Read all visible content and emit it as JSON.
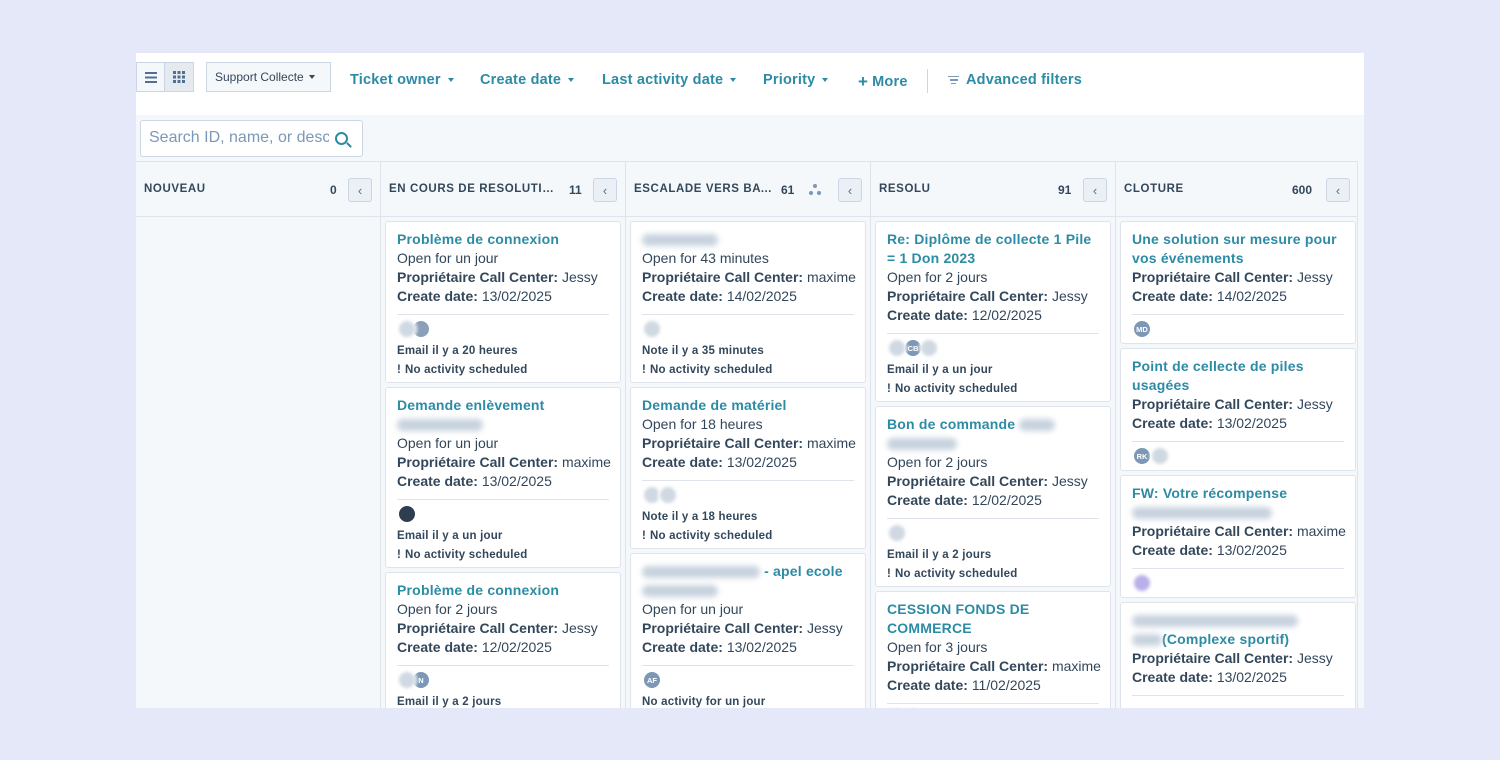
{
  "toolbar": {
    "view_list_icon": "list-view-icon",
    "view_board_icon": "board-view-icon",
    "pipeline": "Support Collecte",
    "filters": {
      "ticket_owner": "Ticket owner",
      "create_date": "Create date",
      "last_activity_date": "Last activity date",
      "priority": "Priority",
      "more": "More",
      "advanced": "Advanced filters"
    }
  },
  "search": {
    "placeholder": "Search ID, name, or desc"
  },
  "columns": [
    {
      "name": "NOUVEAU",
      "count": "0",
      "cards": []
    },
    {
      "name": "EN COURS DE RÉSOLUTION…",
      "count": "11",
      "cards": [
        {
          "title": "Problème de connexion",
          "open": "Open for un jour",
          "owner_label": "Propriétaire Call Center:",
          "owner": "Jessy",
          "date_label": "Create date:",
          "date": "13/02/2025",
          "activity": "Email il y a 20 heures",
          "next": "No activity scheduled"
        },
        {
          "title": "Demande enlèvement",
          "open": "Open for un jour",
          "owner_label": "Propriétaire Call Center:",
          "owner": "maxime",
          "date_label": "Create date:",
          "date": "13/02/2025",
          "activity": "Email il y a un jour",
          "next": "No activity scheduled"
        },
        {
          "title": "Problème de connexion",
          "open": "Open for 2 jours",
          "owner_label": "Propriétaire Call Center:",
          "owner": "Jessy",
          "date_label": "Create date:",
          "date": "12/02/2025",
          "activity": "Email il y a 2 jours",
          "avatar": "N"
        }
      ]
    },
    {
      "name": "ESCALADE VERS BATR…",
      "count": "61",
      "cards": [
        {
          "open": "Open for 43 minutes",
          "owner_label": "Propriétaire Call Center:",
          "owner": "maxime",
          "date_label": "Create date:",
          "date": "14/02/2025",
          "activity": "Note il y a 35 minutes",
          "next": "No activity scheduled"
        },
        {
          "title": "Demande de matériel",
          "open": "Open for 18 heures",
          "owner_label": "Propriétaire Call Center:",
          "owner": "maxime",
          "date_label": "Create date:",
          "date": "13/02/2025",
          "activity": "Note il y a 18 heures",
          "next": "No activity scheduled"
        },
        {
          "title": "- apel ecole",
          "open": "Open for un jour",
          "owner_label": "Propriétaire Call Center:",
          "owner": "Jessy",
          "date_label": "Create date:",
          "date": "13/02/2025",
          "activity": "No activity for un jour",
          "avatar": "AF"
        }
      ]
    },
    {
      "name": "RÉSOLU",
      "count": "91",
      "cards": [
        {
          "title": "Re: Diplôme de collecte 1 Pile = 1 Don 2023",
          "open": "Open for 2 jours",
          "owner_label": "Propriétaire Call Center:",
          "owner": "Jessy",
          "date_label": "Create date:",
          "date": "12/02/2025",
          "activity": "Email il y a un jour",
          "next": "No activity scheduled",
          "avatar": "CB"
        },
        {
          "title": "Bon de commande",
          "open": "Open for 2 jours",
          "owner_label": "Propriétaire Call Center:",
          "owner": "Jessy",
          "date_label": "Create date:",
          "date": "12/02/2025",
          "activity": "Email il y a 2 jours",
          "next": "No activity scheduled"
        },
        {
          "title": "CESSION FONDS DE COMMERCE",
          "open": "Open for 3 jours",
          "owner_label": "Propriétaire Call Center:",
          "owner": "maxime",
          "date_label": "Create date:",
          "date": "11/02/2025"
        }
      ]
    },
    {
      "name": "CLÔTURE",
      "count": "600",
      "cards": [
        {
          "title": "Une solution sur mesure pour vos événements",
          "owner_label": "Propriétaire Call Center:",
          "owner": "Jessy",
          "date_label": "Create date:",
          "date": "14/02/2025",
          "avatar": "MD"
        },
        {
          "title": "Point de cellecte de piles usagées",
          "owner_label": "Propriétaire Call Center:",
          "owner": "Jessy",
          "date_label": "Create date:",
          "date": "13/02/2025",
          "avatar": "RK"
        },
        {
          "title": "FW: Votre récompense",
          "owner_label": "Propriétaire Call Center:",
          "owner": "maxime",
          "date_label": "Create date:",
          "date": "13/02/2025"
        },
        {
          "title": "(Complexe sportif)",
          "owner_label": "Propriétaire Call Center:",
          "owner": "Jessy",
          "date_label": "Create date:",
          "date": "13/02/2025"
        }
      ]
    }
  ],
  "colors": {
    "accent": "#2c8ba5",
    "text": "#33475b",
    "border": "#dfe3eb",
    "background": "#e5e8f8"
  }
}
